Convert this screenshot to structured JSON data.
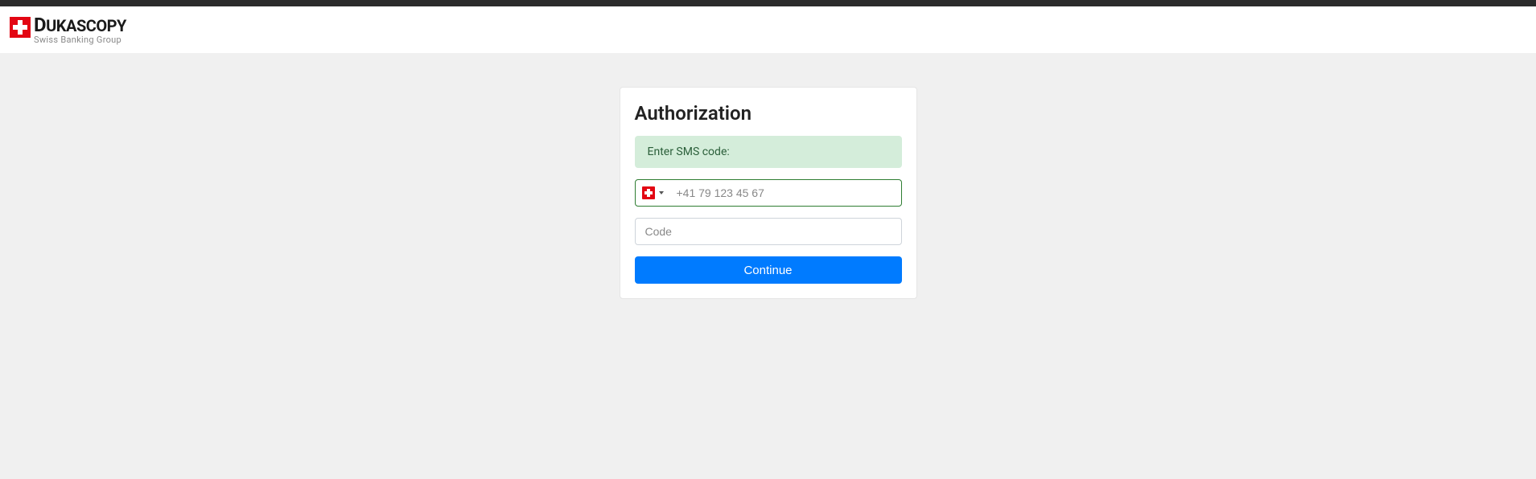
{
  "header": {
    "brand_name": "UKASCOPY",
    "brand_first_letter": "D",
    "brand_tagline": "Swiss Banking Group"
  },
  "card": {
    "title": "Authorization",
    "info_message": "Enter SMS code:",
    "phone_placeholder": "+41 79 123 45 67",
    "phone_value": "",
    "code_placeholder": "Code",
    "code_value": "",
    "continue_label": "Continue",
    "selected_country": "CH"
  }
}
